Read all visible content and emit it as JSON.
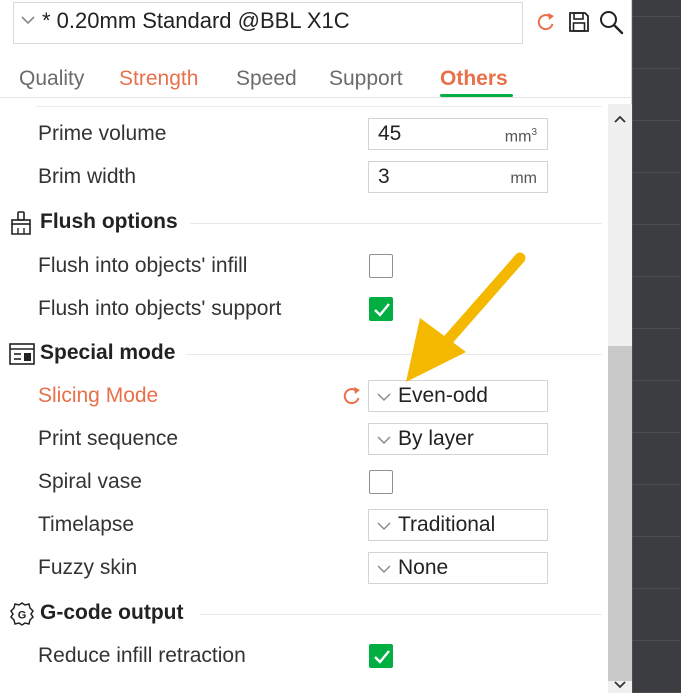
{
  "preset": {
    "name": "* 0.20mm Standard @BBL X1C"
  },
  "tabs": {
    "quality": "Quality",
    "strength": "Strength",
    "speed": "Speed",
    "support": "Support",
    "others": "Others"
  },
  "active_tab": "Others",
  "settings": {
    "prime_volume": {
      "label": "Prime volume",
      "value": "45",
      "unit": "mm",
      "unit_sup": "3"
    },
    "brim_width": {
      "label": "Brim width",
      "value": "3",
      "unit": "mm"
    }
  },
  "flush_options": {
    "title": "Flush options",
    "infill": {
      "label": "Flush into objects' infill",
      "checked": false
    },
    "support": {
      "label": "Flush into objects' support",
      "checked": true
    }
  },
  "special_mode": {
    "title": "Special mode",
    "slicing_mode": {
      "label": "Slicing Mode",
      "value": "Even-odd"
    },
    "print_sequence": {
      "label": "Print sequence",
      "value": "By layer"
    },
    "spiral_vase": {
      "label": "Spiral vase",
      "checked": false
    },
    "timelapse": {
      "label": "Timelapse",
      "value": "Traditional"
    },
    "fuzzy_skin": {
      "label": "Fuzzy skin",
      "value": "None"
    }
  },
  "gcode_output": {
    "title": "G-code output",
    "reduce_infill_retraction": {
      "label": "Reduce infill retraction",
      "checked": true
    }
  },
  "colors": {
    "accent_orange": "#e8704a",
    "check_green": "#00ae42",
    "annotation_arrow": "#f5b800"
  }
}
